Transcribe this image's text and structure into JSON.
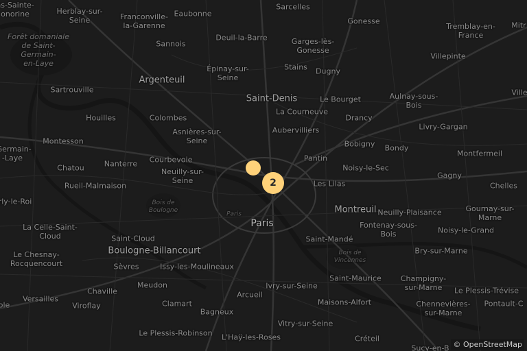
{
  "map": {
    "attribution": "© OpenStreetMap",
    "colors": {
      "background": "#1c1c1c",
      "road": "#2e2e2e",
      "major_road": "#383838",
      "river": "#141414",
      "marker": "#ffd27a"
    },
    "labels": [
      {
        "text": "ns-Sainte-\nonorine",
        "cls": ""
      },
      {
        "text": "Herblay-sur-\nSeine",
        "cls": ""
      },
      {
        "text": "Franconville-\nla-Garenne",
        "cls": ""
      },
      {
        "text": "Eaubonne",
        "cls": ""
      },
      {
        "text": "Sarcelles",
        "cls": ""
      },
      {
        "text": "Gonesse",
        "cls": ""
      },
      {
        "text": "Tremblay-en-\nFrance",
        "cls": ""
      },
      {
        "text": "Mitr",
        "cls": ""
      },
      {
        "text": "Forêt domaniale\nde Saint-\nGermain-\nen-Laye",
        "cls": "italic"
      },
      {
        "text": "Sannois",
        "cls": ""
      },
      {
        "text": "Deuil-la-Barre",
        "cls": ""
      },
      {
        "text": "Garges-lès-\nGonesse",
        "cls": ""
      },
      {
        "text": "Villepinte",
        "cls": ""
      },
      {
        "text": "Argenteuil",
        "cls": "mid"
      },
      {
        "text": "Épinay-sur-\nSeine",
        "cls": ""
      },
      {
        "text": "Stains",
        "cls": ""
      },
      {
        "text": "Dugny",
        "cls": ""
      },
      {
        "text": "Sartrouville",
        "cls": ""
      },
      {
        "text": "Saint-Denis",
        "cls": "mid"
      },
      {
        "text": "Le Bourget",
        "cls": ""
      },
      {
        "text": "Aulnay-sous-\nBois",
        "cls": ""
      },
      {
        "text": "Ville",
        "cls": ""
      },
      {
        "text": "La Courneuve",
        "cls": ""
      },
      {
        "text": "Houilles",
        "cls": ""
      },
      {
        "text": "Colombes",
        "cls": ""
      },
      {
        "text": "Drancy",
        "cls": ""
      },
      {
        "text": "Livry-Gargan",
        "cls": ""
      },
      {
        "text": "Aubervilliers",
        "cls": ""
      },
      {
        "text": "Asnières-sur-\nSeine",
        "cls": ""
      },
      {
        "text": "Montesson",
        "cls": ""
      },
      {
        "text": "Bobigny",
        "cls": ""
      },
      {
        "text": "Bondy",
        "cls": ""
      },
      {
        "text": "-Germain-\n-Laye",
        "cls": ""
      },
      {
        "text": "Montfermeil",
        "cls": ""
      },
      {
        "text": "Courbevoie",
        "cls": ""
      },
      {
        "text": "Pantin",
        "cls": ""
      },
      {
        "text": "Chatou",
        "cls": ""
      },
      {
        "text": "Nanterre",
        "cls": ""
      },
      {
        "text": "Neuilly-sur-\nSeine",
        "cls": ""
      },
      {
        "text": "Noisy-le-Sec",
        "cls": ""
      },
      {
        "text": "Gagny",
        "cls": ""
      },
      {
        "text": "Rueil-Malmaison",
        "cls": ""
      },
      {
        "text": "Les Lilas",
        "cls": ""
      },
      {
        "text": "Chelles",
        "cls": ""
      },
      {
        "text": "rly-le-Roi",
        "cls": ""
      },
      {
        "text": "Bois de\nBoulogne",
        "cls": "small"
      },
      {
        "text": "Montreuil",
        "cls": "mid"
      },
      {
        "text": "Neuilly-Plaisance",
        "cls": ""
      },
      {
        "text": "Gournay-sur-\nMarne",
        "cls": ""
      },
      {
        "text": "Paris",
        "cls": "small"
      },
      {
        "text": "Paris",
        "cls": "major"
      },
      {
        "text": "La Celle-Saint-\nCloud",
        "cls": ""
      },
      {
        "text": "Fontenay-sous-\nBois",
        "cls": ""
      },
      {
        "text": "Noisy-le-Grand",
        "cls": ""
      },
      {
        "text": "Saint-Cloud",
        "cls": ""
      },
      {
        "text": "Saint-Mandé",
        "cls": ""
      },
      {
        "text": "Boulogne-Billancourt",
        "cls": "mid"
      },
      {
        "text": "Le Chesnay-\nRocquencourt",
        "cls": ""
      },
      {
        "text": "Bois de\nVincennes",
        "cls": "small"
      },
      {
        "text": "Bry-sur-Marne",
        "cls": ""
      },
      {
        "text": "Sèvres",
        "cls": ""
      },
      {
        "text": "Issy-les-Moulineaux",
        "cls": ""
      },
      {
        "text": "Saint-Maurice",
        "cls": ""
      },
      {
        "text": "Champigny-\nsur-Marne",
        "cls": ""
      },
      {
        "text": "Meudon",
        "cls": ""
      },
      {
        "text": "Ivry-sur-Seine",
        "cls": ""
      },
      {
        "text": "Le Plessis-Trévise",
        "cls": ""
      },
      {
        "text": "Chaville",
        "cls": ""
      },
      {
        "text": "Arcueil",
        "cls": ""
      },
      {
        "text": "Versailles",
        "cls": ""
      },
      {
        "text": "Viroflay",
        "cls": ""
      },
      {
        "text": "Clamart",
        "cls": ""
      },
      {
        "text": "Maisons-Alfort",
        "cls": ""
      },
      {
        "text": "Chennevières-\nsur-Marne",
        "cls": ""
      },
      {
        "text": "Pontault-C",
        "cls": ""
      },
      {
        "text": "ole",
        "cls": ""
      },
      {
        "text": "Bagneux",
        "cls": ""
      },
      {
        "text": "Vitry-sur-Seine",
        "cls": ""
      },
      {
        "text": "Le Plessis-Robinson",
        "cls": ""
      },
      {
        "text": "L'Haÿ-les-Roses",
        "cls": ""
      },
      {
        "text": "Créteil",
        "cls": ""
      },
      {
        "text": "Sucy-en-B",
        "cls": ""
      }
    ],
    "markers": [
      {
        "label": "",
        "name": "point-marker"
      },
      {
        "label": "2",
        "name": "cluster-marker"
      }
    ]
  }
}
